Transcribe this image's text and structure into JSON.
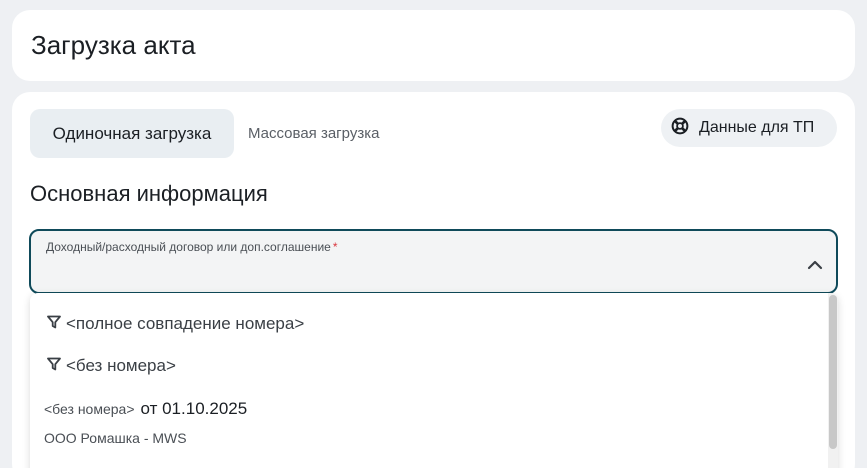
{
  "header": {
    "title": "Загрузка акта"
  },
  "tabs": {
    "single": "Одиночная загрузка",
    "mass": "Массовая загрузка"
  },
  "support_button": {
    "label": "Данные для ТП",
    "icon": "lifebuoy-icon"
  },
  "section": {
    "title": "Основная информация"
  },
  "contract_select": {
    "label": "Доходный/расходный договор или доп.соглашение",
    "required_mark": "*",
    "icon": "chevron-up-icon"
  },
  "dropdown": {
    "options": [
      {
        "icon": "filter-icon",
        "text": "<полное совпадение номера>"
      },
      {
        "icon": "filter-icon",
        "text": "<без номера>"
      }
    ],
    "item": {
      "number": "<без номера>",
      "date": "от 01.10.2025",
      "org": "ООО Ромашка - MWS"
    }
  },
  "colors": {
    "accent_border": "#0f4a5a",
    "required": "#d9363e",
    "active_tab_bg": "#e9eef2"
  }
}
